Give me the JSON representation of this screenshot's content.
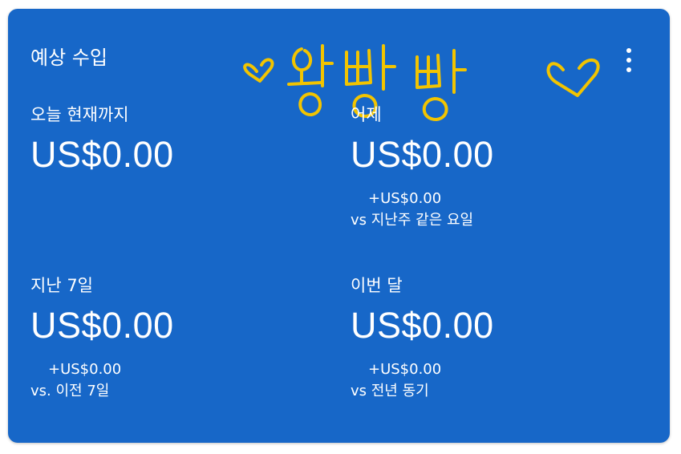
{
  "card": {
    "title": "예상 수입",
    "doodle_text": "♡ 왕빵빵 ♡",
    "more_icon": "more-vert-icon"
  },
  "metrics": [
    {
      "label": "오늘 현재까지",
      "value": "US$0.00",
      "change": "",
      "compare": ""
    },
    {
      "label": "어제",
      "value": "US$0.00",
      "change": "+US$0.00",
      "compare": "vs 지난주 같은 요일"
    },
    {
      "label": "지난 7일",
      "value": "US$0.00",
      "change": "+US$0.00",
      "compare": "vs. 이전 7일"
    },
    {
      "label": "이번 달",
      "value": "US$0.00",
      "change": "+US$0.00",
      "compare": "vs 전년 동기"
    }
  ],
  "colors": {
    "card_background": "#1767c8",
    "text": "#ffffff",
    "doodle": "#f2c400"
  }
}
